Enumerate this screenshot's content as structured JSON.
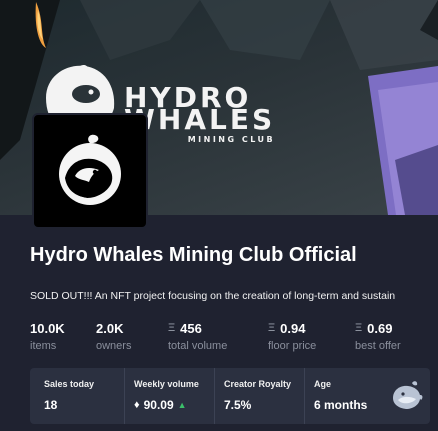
{
  "banner": {
    "wordmark_line1": "HYDRO",
    "wordmark_line2": "WHALES",
    "wordmark_line3": "MINING CLUB"
  },
  "collection": {
    "title": "Hydro Whales Mining Club Official",
    "description": "SOLD OUT!!! An NFT project focusing on the creation of long-term and sustain"
  },
  "stats": [
    {
      "value": "10.0K",
      "label": "items",
      "currency": ""
    },
    {
      "value": "2.0K",
      "label": "owners",
      "currency": ""
    },
    {
      "value": "456",
      "label": "total volume",
      "currency": "Ξ"
    },
    {
      "value": "0.94",
      "label": "floor price",
      "currency": "Ξ"
    },
    {
      "value": "0.69",
      "label": "best offer",
      "currency": "Ξ"
    }
  ],
  "sales_panel": {
    "sales_today_label": "Sales today",
    "sales_today_value": "18",
    "weekly_volume_label": "Weekly volume",
    "weekly_volume_value": "90.09",
    "weekly_volume_currency": "♦",
    "weekly_trend_icon": "▲",
    "creator_royalty_label": "Creator Royalty",
    "creator_royalty_value": "7.5%",
    "age_label": "Age",
    "age_value": "6 months"
  },
  "colors": {
    "background": "#1f2230",
    "panel": "#2b3040",
    "muted_text": "#8a8f9c",
    "trend_up": "#3bbf6a"
  },
  "icons": {
    "avatar": "whale-logo-icon",
    "currency": "eth-icon",
    "trend": "arrow-up-icon",
    "panel_logo": "whale-mascot-icon"
  }
}
